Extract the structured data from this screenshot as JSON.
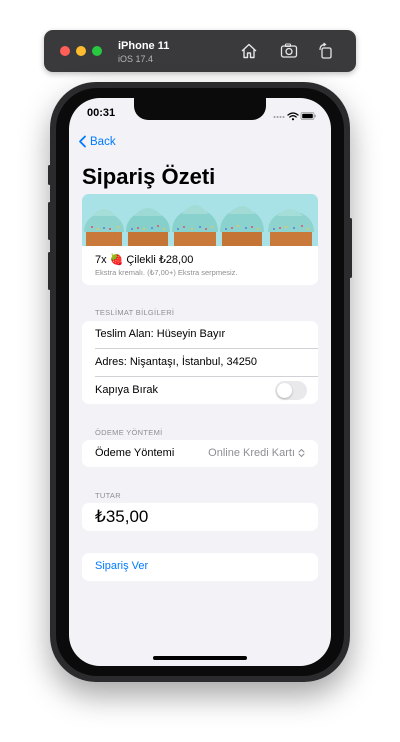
{
  "simulator": {
    "device_name": "iPhone 11",
    "os_version": "iOS 17.4"
  },
  "status_bar": {
    "time": "00:31"
  },
  "nav": {
    "back_label": "Back"
  },
  "page": {
    "title": "Sipariş Özeti"
  },
  "order_item": {
    "line": "7x 🍓 Çilekli ₺28,00",
    "quantity": "7x",
    "name": "Çilekli",
    "price": "₺28,00",
    "note": "Ekstra kremalı. (₺7,00+) Ekstra serpmesiz."
  },
  "delivery": {
    "section_label": "TESLİMAT BİLGİLERİ",
    "recipient": "Teslim Alan: Hüseyin Bayır",
    "address": "Adres: Nişantaşı, İstanbul, 34250",
    "leave_at_door_label": "Kapıya Bırak",
    "leave_at_door_on": false
  },
  "payment": {
    "section_label": "ÖDEME YÖNTEMİ",
    "method_label": "Ödeme Yöntemi",
    "method_value": "Online Kredi Kartı"
  },
  "total": {
    "section_label": "TUTAR",
    "amount": "₺35,00"
  },
  "actions": {
    "place_order_label": "Sipariş Ver"
  },
  "colors": {
    "accent": "#007aff",
    "background": "#f2f2f7",
    "secondary_text": "#8e8e93"
  },
  "icons": [
    "home-icon",
    "screenshot-icon",
    "rotate-icon",
    "chevron-left-icon",
    "wifi-icon",
    "battery-icon",
    "strawberry-icon",
    "chevron-updown-icon"
  ]
}
